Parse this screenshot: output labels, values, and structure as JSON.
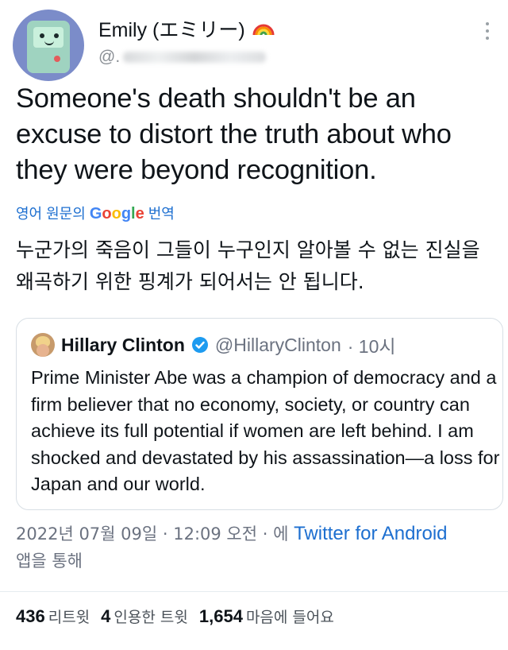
{
  "author": {
    "display_name": "Emily (エミリー)",
    "name_emoji": "rainbow-icon",
    "handle_visible": "@."
  },
  "tweet": {
    "text": "Someone's death shouldn't be an excuse to distort the truth about who they were beyond recognition.",
    "translate_prefix": "영어 원문의",
    "translate_brand": [
      "G",
      "o",
      "o",
      "g",
      "l",
      "e"
    ],
    "translate_suffix": "번역",
    "translation": "누군가의 죽음이 그들이 누구인지 알아볼 수 없는 진실을 왜곡하기 위한 핑계가 되어서는 안 됩니다."
  },
  "quote": {
    "name": "Hillary Clinton",
    "handle": "@HillaryClinton",
    "time": "· 10시",
    "text": "Prime Minister Abe was a champion of democracy and a firm believer that no economy, society, or country can achieve its full potential if women are left behind. I am shocked and devastated by his assassination—a loss for Japan and our world."
  },
  "meta": {
    "timestamp": "2022년 07월 09일 · 12:09 오전 · 에",
    "source": "Twitter for Android",
    "source_suffix": "앱을 통해"
  },
  "stats": [
    {
      "count": "436",
      "label": "리트윗"
    },
    {
      "count": "4",
      "label": "인용한 트윗"
    },
    {
      "count": "1,654",
      "label": "마음에 들어요"
    }
  ],
  "colors": {
    "link": "#1d6fd0",
    "verified": "#1d9bf0",
    "muted": "#6b7280"
  }
}
